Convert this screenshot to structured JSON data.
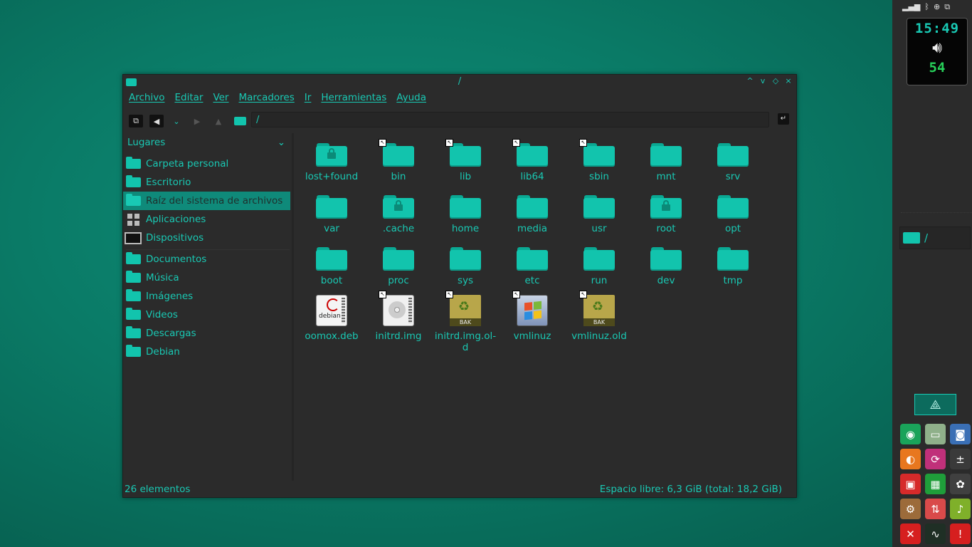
{
  "window": {
    "title": "/",
    "controls": [
      "^",
      "v",
      "◇",
      "×"
    ]
  },
  "menubar": [
    "Archivo",
    "Editar",
    "Ver",
    "Marcadores",
    "Ir",
    "Herramientas",
    "Ayuda"
  ],
  "location": {
    "path": "/"
  },
  "sidebar": {
    "header": "Lugares",
    "places": [
      {
        "label": "Carpeta personal",
        "icon": "home-folder-icon"
      },
      {
        "label": "Escritorio",
        "icon": "desktop-folder-icon"
      },
      {
        "label": "Raíz del sistema de archivos",
        "icon": "folder-icon",
        "active": true
      },
      {
        "label": "Aplicaciones",
        "icon": "applications-grid-icon"
      },
      {
        "label": "Dispositivos",
        "icon": "monitor-icon"
      }
    ],
    "bookmarks": [
      {
        "label": "Documentos",
        "icon": "documents-folder-icon"
      },
      {
        "label": "Música",
        "icon": "music-folder-icon"
      },
      {
        "label": "Imágenes",
        "icon": "pictures-folder-icon"
      },
      {
        "label": "Videos",
        "icon": "videos-folder-icon"
      },
      {
        "label": "Descargas",
        "icon": "downloads-folder-icon"
      },
      {
        "label": "Debian",
        "icon": "folder-icon"
      }
    ]
  },
  "files": [
    {
      "name": "lost+found",
      "type": "folder-locked",
      "link": false
    },
    {
      "name": "bin",
      "type": "folder",
      "link": true
    },
    {
      "name": "lib",
      "type": "folder",
      "link": true
    },
    {
      "name": "lib64",
      "type": "folder",
      "link": true
    },
    {
      "name": "sbin",
      "type": "folder",
      "link": true
    },
    {
      "name": "mnt",
      "type": "folder",
      "link": false
    },
    {
      "name": "srv",
      "type": "folder",
      "link": false
    },
    {
      "name": "var",
      "type": "folder",
      "link": false
    },
    {
      "name": ".cache",
      "type": "folder-locked",
      "link": false
    },
    {
      "name": "home",
      "type": "folder",
      "link": false
    },
    {
      "name": "media",
      "type": "folder",
      "link": false
    },
    {
      "name": "usr",
      "type": "folder",
      "link": false
    },
    {
      "name": "root",
      "type": "folder-locked",
      "link": false
    },
    {
      "name": "opt",
      "type": "folder",
      "link": false
    },
    {
      "name": "boot",
      "type": "folder",
      "link": false
    },
    {
      "name": "proc",
      "type": "folder",
      "link": false
    },
    {
      "name": "sys",
      "type": "folder",
      "link": false
    },
    {
      "name": "etc",
      "type": "folder",
      "link": false
    },
    {
      "name": "run",
      "type": "folder",
      "link": false
    },
    {
      "name": "dev",
      "type": "folder",
      "link": false
    },
    {
      "name": "tmp",
      "type": "folder",
      "link": false
    },
    {
      "name": "oomox.deb",
      "type": "deb",
      "link": false,
      "icon_text": "debian"
    },
    {
      "name": "initrd.img",
      "type": "disk-image",
      "link": true
    },
    {
      "name": "initrd.img.ol-\nd",
      "type": "backup",
      "link": true,
      "icon_text": "BAK"
    },
    {
      "name": "vmlinuz",
      "type": "windows",
      "link": true
    },
    {
      "name": "vmlinuz.old",
      "type": "backup",
      "link": true,
      "icon_text": "BAK"
    }
  ],
  "status": {
    "count": "26 elementos",
    "free": "Espacio libre: 6,3 GiB (total: 18,2 GiB)"
  },
  "panel": {
    "clock": "15:49",
    "volume": "54",
    "task": {
      "label": "/"
    },
    "launchers": [
      {
        "name": "chrome-icon",
        "color": "#1aa35a",
        "glyph": "◉"
      },
      {
        "name": "file-manager-icon",
        "color": "#8fb08a",
        "glyph": "▭"
      },
      {
        "name": "screenshot-icon",
        "color": "#3a6fb5",
        "glyph": "◙"
      },
      {
        "name": "firefox-icon",
        "color": "#e8771f",
        "glyph": "◐"
      },
      {
        "name": "sync-icon",
        "color": "#c0307a",
        "glyph": "⟳"
      },
      {
        "name": "calculator-icon",
        "color": "#3a3a3a",
        "glyph": "±"
      },
      {
        "name": "archive-manager-icon",
        "color": "#d62a2a",
        "glyph": "▣"
      },
      {
        "name": "spreadsheet-icon",
        "color": "#1f9e3a",
        "glyph": "▦"
      },
      {
        "name": "color-picker-icon",
        "color": "#404040",
        "glyph": "✿"
      },
      {
        "name": "network-icon",
        "color": "#9c6b3a",
        "glyph": "⚙"
      },
      {
        "name": "updates-icon",
        "color": "#d94a4a",
        "glyph": "⇅"
      },
      {
        "name": "music-player-icon",
        "color": "#7fb02a",
        "glyph": "♪"
      },
      {
        "name": "logout-icon",
        "color": "#d61f1f",
        "glyph": "✕"
      },
      {
        "name": "system-monitor-icon",
        "color": "#1f2f25",
        "glyph": "∿"
      },
      {
        "name": "alert-icon",
        "color": "#d61f1f",
        "glyph": "!"
      }
    ]
  }
}
